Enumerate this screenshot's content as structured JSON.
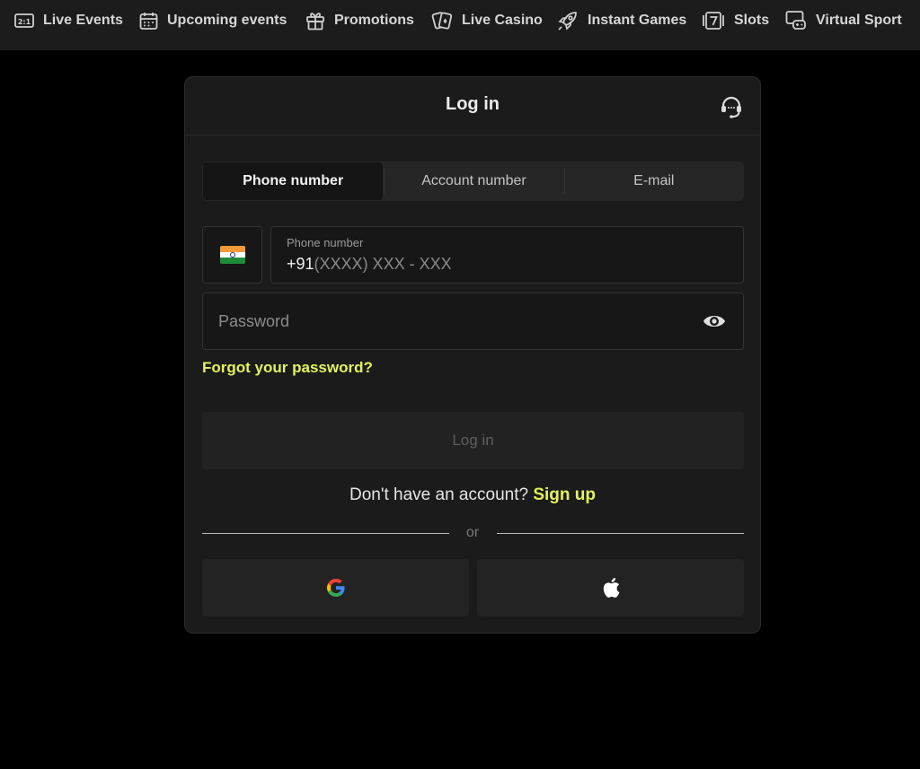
{
  "nav": {
    "items": [
      {
        "label": "Live Events",
        "icon": "live-events-icon"
      },
      {
        "label": "Upcoming events",
        "icon": "calendar-icon"
      },
      {
        "label": "Promotions",
        "icon": "gift-icon"
      },
      {
        "label": "Live Casino",
        "icon": "cards-icon"
      },
      {
        "label": "Instant Games",
        "icon": "rocket-icon"
      },
      {
        "label": "Slots",
        "icon": "slot-seven-icon"
      },
      {
        "label": "Virtual Sport",
        "icon": "gamepad-monitor-icon"
      }
    ],
    "live_events_icon_text": "2:1"
  },
  "modal": {
    "title": "Log in",
    "support_icon": "headset-icon",
    "tabs": [
      {
        "label": "Phone number",
        "active": true
      },
      {
        "label": "Account number",
        "active": false
      },
      {
        "label": "E-mail",
        "active": false
      }
    ],
    "country_flag": "india-flag-icon",
    "phone": {
      "label": "Phone number",
      "prefix": "+91",
      "mask": "(XXXX) XXX - XXX"
    },
    "password": {
      "placeholder": "Password",
      "toggle_icon": "eye-icon"
    },
    "forgot_label": "Forgot your password?",
    "login_label": "Log in",
    "signup_prompt": "Don't have an account?",
    "signup_link": "Sign up",
    "or_label": "or",
    "social": [
      {
        "provider": "Google",
        "icon": "google-icon"
      },
      {
        "provider": "Apple",
        "icon": "apple-icon"
      }
    ]
  },
  "colors": {
    "accent": "#e5f25c",
    "background": "#000000",
    "nav_background": "#1c1c1c",
    "modal_background": "#1b1b1b"
  }
}
